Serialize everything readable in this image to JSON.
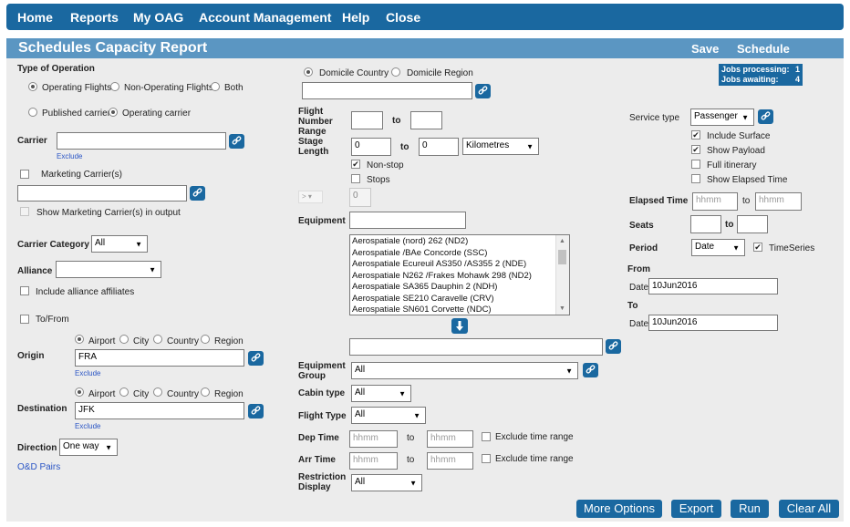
{
  "nav": {
    "items": [
      "Home",
      "Reports",
      "My OAG",
      "Account Management",
      "Help",
      "Close"
    ]
  },
  "header": {
    "title": "Schedules Capacity Report",
    "save": "Save",
    "schedule": "Schedule"
  },
  "jobs": {
    "processing_label": "Jobs processing:",
    "processing_count": "1",
    "awaiting_label": "Jobs awaiting:",
    "awaiting_count": "4"
  },
  "left": {
    "type_of_operation": "Type of Operation",
    "operating_flights": "Operating Flights",
    "non_operating_flights": "Non-Operating Flights",
    "both": "Both",
    "published_carrier": "Published carrier",
    "operating_carrier": "Operating carrier",
    "carrier_label": "Carrier",
    "carrier_value": "",
    "exclude": "Exclude",
    "marketing_carriers": "Marketing Carrier(s)",
    "marketing_value": "",
    "show_marketing": "Show Marketing Carrier(s) in output",
    "carrier_category_label": "Carrier Category",
    "carrier_category_value": "All",
    "alliance_label": "Alliance",
    "alliance_value": "",
    "include_alliance": "Include alliance affiliates",
    "to_from": "To/From",
    "origin_label": "Origin",
    "origin_value": "FRA",
    "destination_label": "Destination",
    "destination_value": "JFK",
    "airport": "Airport",
    "city": "City",
    "country": "Country",
    "region": "Region",
    "direction_label": "Direction",
    "direction_value": "One way",
    "od_pairs": "O&D Pairs"
  },
  "middle": {
    "domicile_country": "Domicile Country",
    "domicile_region": "Domicile Region",
    "domicile_value": "",
    "flight_number_range_label": "Flight Number Range",
    "to": "to",
    "flight_from": "",
    "flight_to": "",
    "stage_length_label": "Stage Length",
    "stage_from": "0",
    "stage_to": "0",
    "stage_unit": "Kilometres",
    "non_stop": "Non-stop",
    "stops": "Stops",
    "stops_operator": "> ▾",
    "stops_value": "0",
    "equipment_label": "Equipment",
    "equipment_value": "",
    "equipment_list": [
      "Aerospatiale (nord) 262 (ND2)",
      "Aerospatiale /BAe Concorde (SSC)",
      "Aerospatiale Ecureuil AS350 /AS355 2 (NDE)",
      "Aerospatiale N262 /Frakes Mohawk 298 (ND2)",
      "Aerospatiale SA365 Dauphin 2 (NDH)",
      "Aerospatiale SE210 Caravelle (CRV)",
      "Aerospatiale SN601 Corvette (NDC)"
    ],
    "selected_equipment": "",
    "equipment_group_label": "Equipment Group",
    "equipment_group_value": "All",
    "cabin_type_label": "Cabin type",
    "cabin_type_value": "All",
    "flight_type_label": "Flight Type",
    "flight_type_value": "All",
    "dep_time_label": "Dep Time",
    "arr_time_label": "Arr Time",
    "time_placeholder": "hhmm",
    "exclude_time_range": "Exclude time range",
    "restriction_display_label": "Restriction Display",
    "restriction_display_value": "All"
  },
  "right": {
    "service_type_label": "Service type",
    "service_type_value": "Passenger",
    "include_surface": "Include Surface",
    "show_payload": "Show Payload",
    "full_itinerary": "Full itinerary",
    "show_elapsed_time": "Show Elapsed Time",
    "elapsed_time_label": "Elapsed Time",
    "time_placeholder": "hhmm",
    "to": "to",
    "seats_label": "Seats",
    "seats_from": "",
    "seats_to": "",
    "period_label": "Period",
    "period_value": "Date",
    "timeseries": "TimeSeries",
    "from_label": "From",
    "to_label": "To",
    "date_label": "Date",
    "date_from": "10Jun2016",
    "date_to": "10Jun2016"
  },
  "buttons": {
    "more_options": "More Options",
    "export": "Export",
    "run": "Run",
    "clear_all": "Clear All"
  },
  "colors": {
    "nav": "#1a68a0",
    "title_bar": "#5b96c2",
    "panel": "#ececec",
    "link": "#2a55c5"
  },
  "icons": {
    "link": "link-icon",
    "arrow_down": "arrow-down-icon"
  }
}
